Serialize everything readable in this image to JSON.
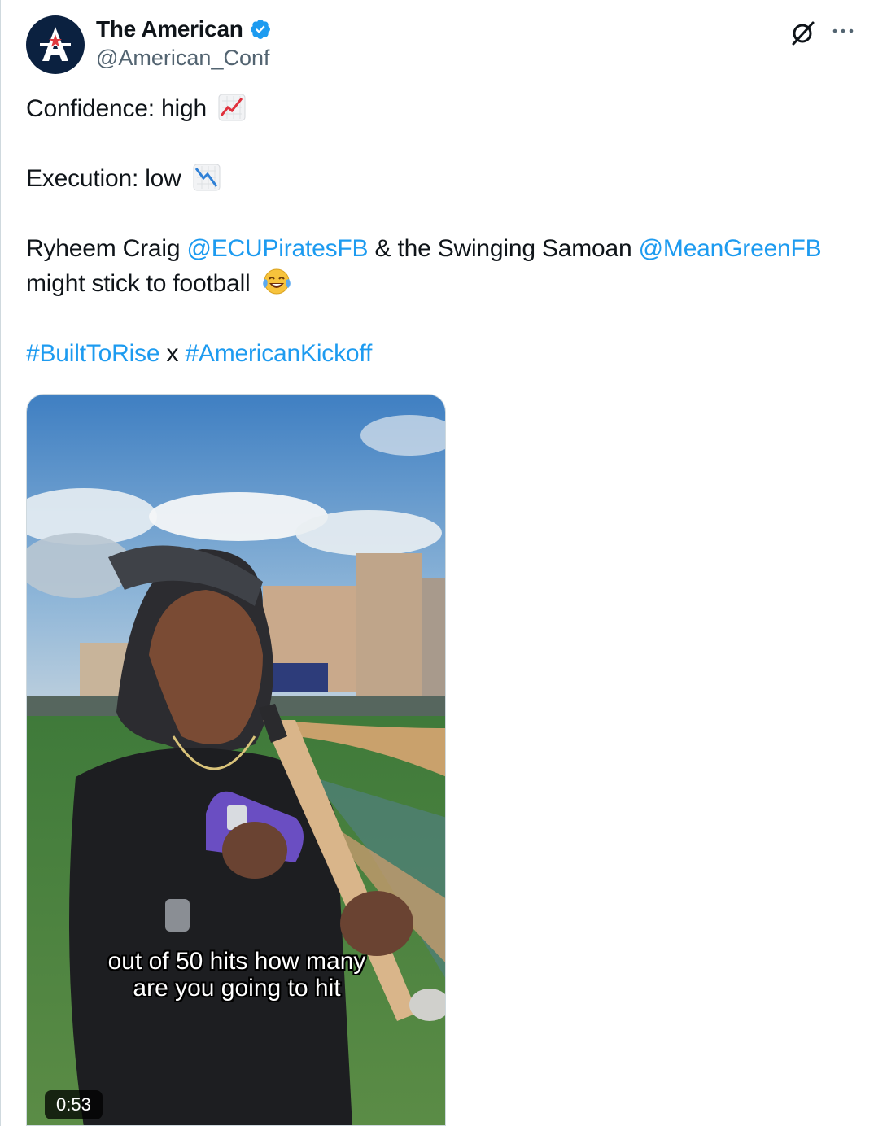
{
  "author": {
    "display_name": "The American",
    "handle": "@American_Conf",
    "verified": true,
    "avatar_icon": "american-conference-logo"
  },
  "header_actions": {
    "grok_icon": "grok-icon",
    "more_icon": "more-horizontal-icon"
  },
  "tweet": {
    "line1_text": "Confidence: high",
    "line1_emoji": "chart-increasing",
    "line2_text": "Execution: low",
    "line2_emoji": "chart-decreasing",
    "line3_part1": "Ryheem Craig ",
    "mention1": "@ECUPiratesFB",
    "line3_part2": " & the Swinging Samoan ",
    "mention2": "@MeanGreenFB",
    "line3_part3": "might stick to football",
    "line3_emoji": "face-with-tears-of-joy",
    "hashtag1": "#BuiltToRise",
    "hashtag_sep": " x ",
    "hashtag2": "#AmericanKickoff"
  },
  "video": {
    "caption_line1": "out of 50 hits how many",
    "caption_line2": "are you going to hit",
    "duration": "0:53"
  },
  "colors": {
    "link": "#1d9bf0",
    "verified": "#1d9bf0",
    "text": "#0f1419",
    "secondary": "#536471"
  }
}
